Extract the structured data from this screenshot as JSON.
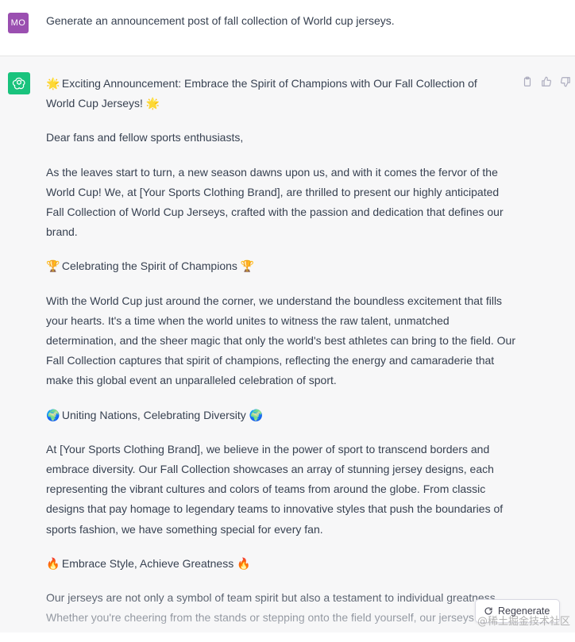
{
  "user": {
    "avatar_initials": "MO",
    "avatar_color": "#9a4fb0",
    "prompt": "Generate an announcement post of fall collection of World cup jerseys."
  },
  "assistant": {
    "avatar_color": "#19c37d",
    "avatar_icon": "openai-logo-icon",
    "title_line1": "Exciting Announcement: Embrace the Spirit of Champions with Our Fall Collection of",
    "title_line2": "World Cup Jerseys!",
    "greeting": "Dear fans and fellow sports enthusiasts,",
    "para1": "As the leaves start to turn, a new season dawns upon us, and with it comes the fervor of the World Cup! We, at [Your Sports Clothing Brand], are thrilled to present our highly anticipated Fall Collection of World Cup Jerseys, crafted with the passion and dedication that defines our brand.",
    "heading1": "Celebrating the Spirit of Champions",
    "para2": "With the World Cup just around the corner, we understand the boundless excitement that fills your hearts. It's a time when the world unites to witness the raw talent, unmatched determination, and the sheer magic that only the world's best athletes can bring to the field. Our Fall Collection captures that spirit of champions, reflecting the energy and camaraderie that make this global event an unparalleled celebration of sport.",
    "heading2": "Uniting Nations, Celebrating Diversity",
    "para3": "At [Your Sports Clothing Brand], we believe in the power of sport to transcend borders and embrace diversity. Our Fall Collection showcases an array of stunning jersey designs, each representing the vibrant cultures and colors of teams from around the globe. From classic designs that pay homage to legendary teams to innovative styles that push the boundaries of sports fashion, we have something special for every fan.",
    "heading3": "Embrace Style, Achieve Greatness",
    "para4": "Our jerseys are not only a symbol of team spirit but also a testament to individual greatness. Whether you're cheering from the stands or stepping onto the field yourself, our jerseys",
    "emoji": {
      "sun": "🌟",
      "trophy": "🏆",
      "globe": "🌍",
      "fire": "🔥"
    }
  },
  "actions": {
    "copy_icon": "clipboard-icon",
    "like_icon": "thumbs-up-icon",
    "dislike_icon": "thumbs-down-icon"
  },
  "regenerate": {
    "label": "Regenerate",
    "icon": "refresh-icon"
  },
  "watermark": "@稀土掘金技术社区"
}
